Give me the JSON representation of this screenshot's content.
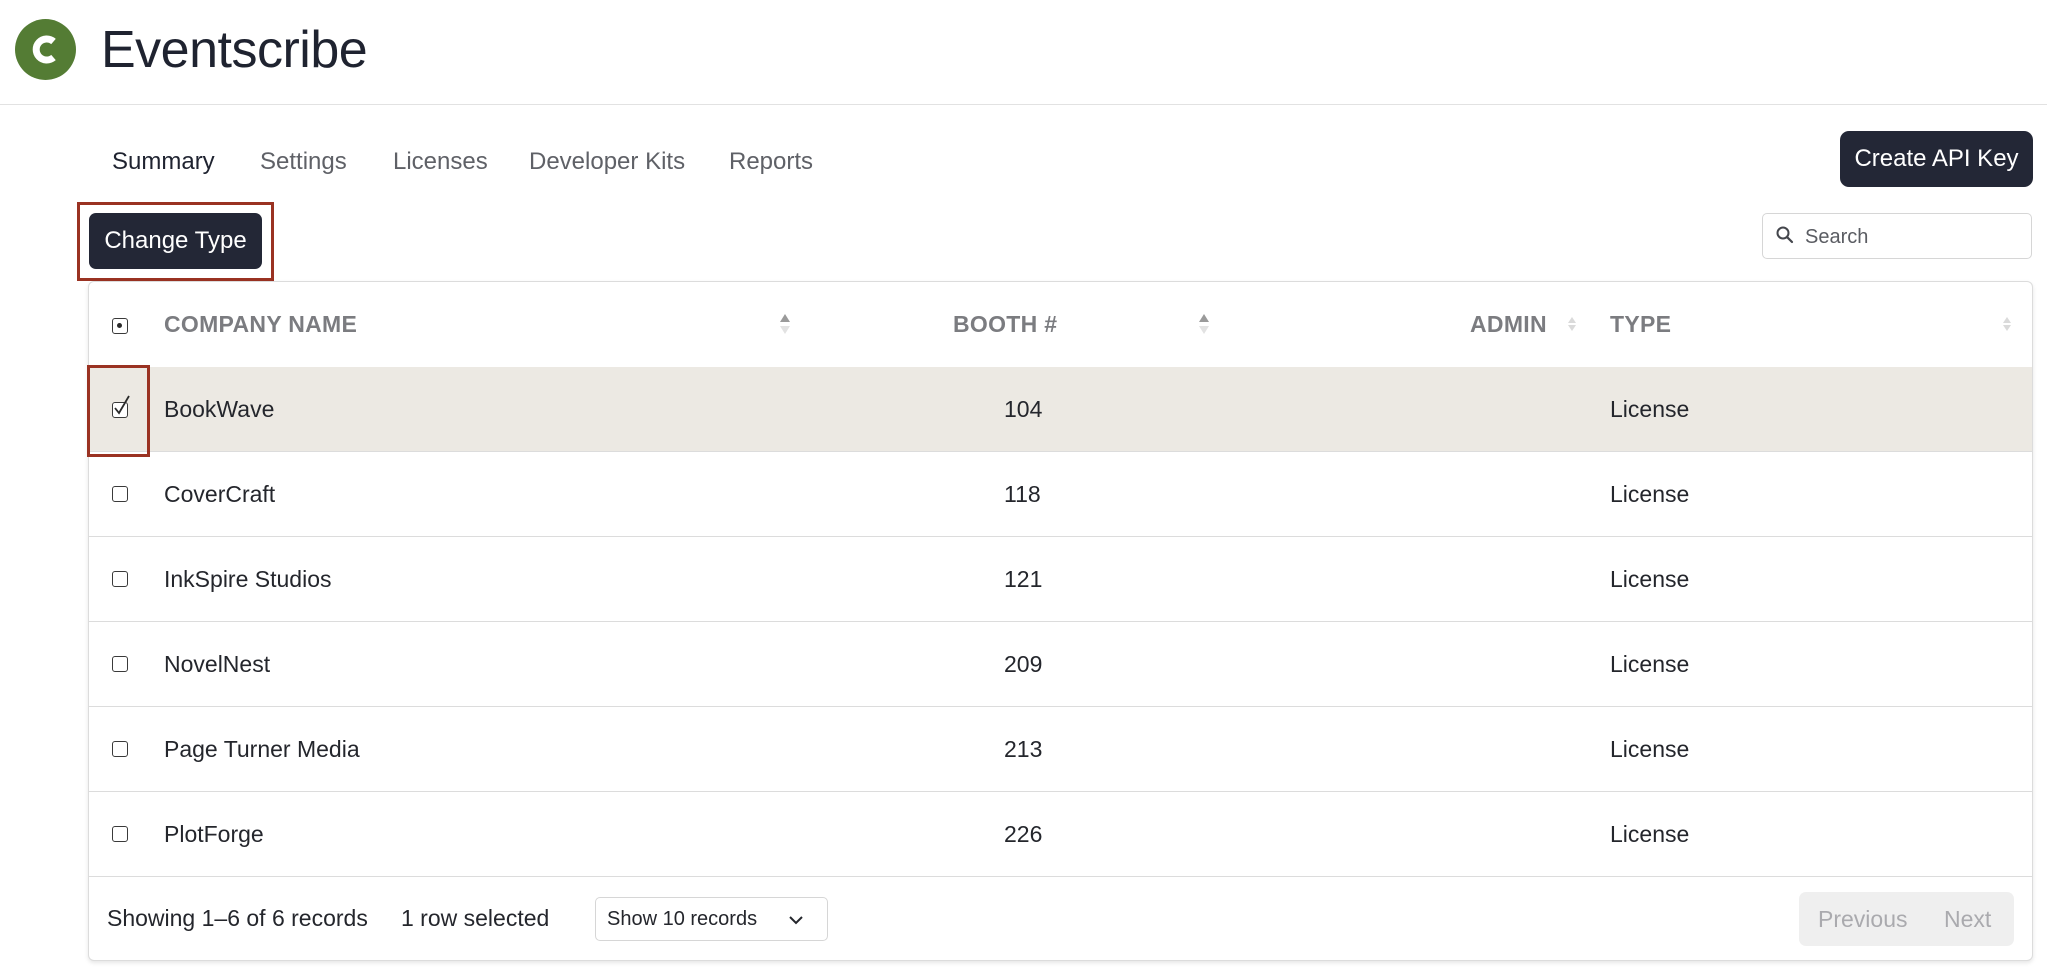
{
  "app": {
    "name": "Eventscribe",
    "logo_letter": "C",
    "accent": "#547c34"
  },
  "nav": {
    "tabs": [
      {
        "label": "Summary",
        "active": true
      },
      {
        "label": "Settings"
      },
      {
        "label": "Licenses"
      },
      {
        "label": "Developer Kits"
      },
      {
        "label": "Reports"
      }
    ]
  },
  "actions": {
    "create_api_key": "Create API Key",
    "change_type": "Change Type"
  },
  "search": {
    "placeholder": "Search",
    "value": ""
  },
  "table": {
    "columns": {
      "company": "COMPANY NAME",
      "booth": "BOOTH #",
      "admin": "ADMIN",
      "type": "TYPE"
    },
    "rows": [
      {
        "company": "BookWave",
        "booth": "104",
        "admin": "",
        "type": "License",
        "selected": true
      },
      {
        "company": "CoverCraft",
        "booth": "118",
        "admin": "",
        "type": "License",
        "selected": false
      },
      {
        "company": "InkSpire Studios",
        "booth": "121",
        "admin": "",
        "type": "License",
        "selected": false
      },
      {
        "company": "NovelNest",
        "booth": "209",
        "admin": "",
        "type": "License",
        "selected": false
      },
      {
        "company": "Page Turner Media",
        "booth": "213",
        "admin": "",
        "type": "License",
        "selected": false
      },
      {
        "company": "PlotForge",
        "booth": "226",
        "admin": "",
        "type": "License",
        "selected": false
      }
    ]
  },
  "footer": {
    "showing": "Showing 1–6 of 6 records",
    "selected": "1 row selected",
    "page_size": "Show 10 records",
    "previous": "Previous",
    "next": "Next"
  },
  "colors": {
    "dark_button": "#232736",
    "highlight": "#9a3222",
    "selected_row": "#ece9e3"
  }
}
